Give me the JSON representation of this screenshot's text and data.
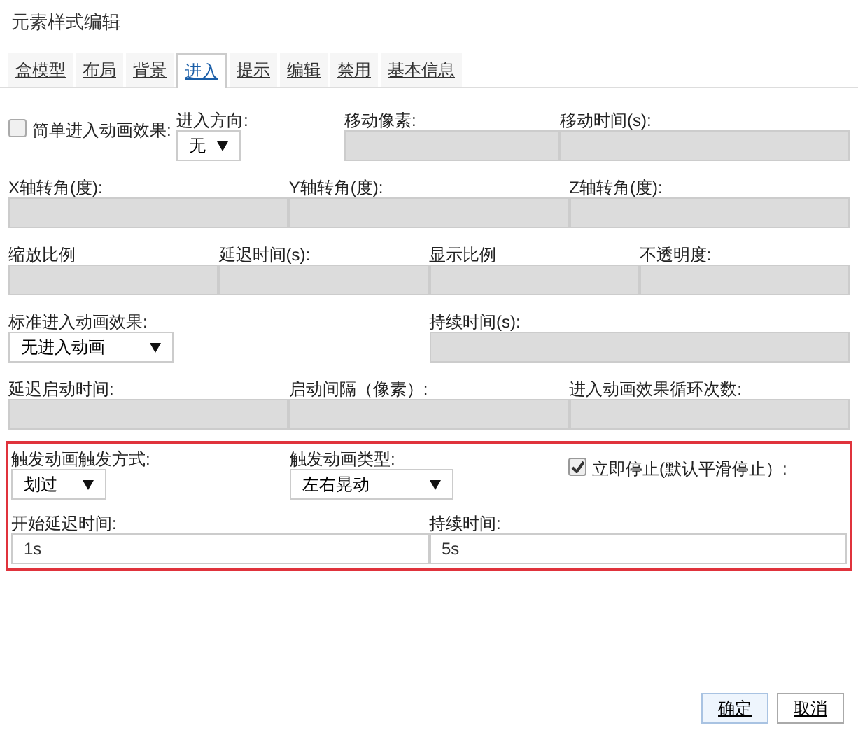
{
  "window": {
    "title": "元素样式编辑"
  },
  "tabs": [
    {
      "label": "盒模型",
      "selected": false
    },
    {
      "label": "布局",
      "selected": false
    },
    {
      "label": "背景",
      "selected": false
    },
    {
      "label": "进入",
      "selected": true
    },
    {
      "label": "提示",
      "selected": false
    },
    {
      "label": "编辑",
      "selected": false
    },
    {
      "label": "禁用",
      "selected": false
    },
    {
      "label": "基本信息",
      "selected": false
    }
  ],
  "rows": [
    {
      "fields": [
        {
          "kind": "checkbox",
          "label": "简单进入动画效果:",
          "checked": false
        },
        {
          "kind": "select",
          "label": "进入方向:",
          "value": "无"
        },
        {
          "kind": "input",
          "label": "移动像素:",
          "disabled": true
        },
        {
          "kind": "input",
          "label": "移动时间(s):",
          "disabled": true
        }
      ]
    },
    {
      "fields": [
        {
          "kind": "input",
          "label": "X轴转角(度):",
          "disabled": true
        },
        {
          "kind": "input",
          "label": "Y轴转角(度):",
          "disabled": true
        },
        {
          "kind": "input",
          "label": "Z轴转角(度):",
          "disabled": true
        }
      ]
    },
    {
      "fields": [
        {
          "kind": "input",
          "label": "缩放比例",
          "disabled": true
        },
        {
          "kind": "input",
          "label": "延迟时间(s):",
          "disabled": true
        },
        {
          "kind": "input",
          "label": "显示比例",
          "disabled": true
        },
        {
          "kind": "input",
          "label": "不透明度:",
          "disabled": true
        }
      ]
    },
    {
      "fields": [
        {
          "kind": "select",
          "label": "标准进入动画效果:",
          "value": "无进入动画"
        },
        {
          "kind": "input",
          "label": "持续时间(s):",
          "disabled": true
        }
      ]
    },
    {
      "fields": [
        {
          "kind": "input",
          "label": "延迟启动时间:",
          "disabled": true
        },
        {
          "kind": "input",
          "label": "启动间隔（像素）:",
          "disabled": true
        },
        {
          "kind": "input",
          "label": "进入动画效果循环次数:",
          "disabled": true
        }
      ]
    }
  ],
  "trigger": {
    "highlighted": true,
    "rows": [
      {
        "fields": [
          {
            "kind": "select",
            "label": "触发动画触发方式:",
            "value": "划过"
          },
          {
            "kind": "select",
            "label": "触发动画类型:",
            "value": "左右晃动"
          },
          {
            "kind": "checkbox",
            "label": "立即停止(默认平滑停止）:",
            "checked": true
          }
        ]
      },
      {
        "fields": [
          {
            "kind": "input",
            "label": "开始延迟时间:",
            "value": "1s",
            "disabled": false
          },
          {
            "kind": "input",
            "label": "持续时间:",
            "value": "5s",
            "disabled": false
          }
        ]
      }
    ]
  },
  "buttons": [
    {
      "label": "确定",
      "primary": true
    },
    {
      "label": "取消",
      "primary": false
    }
  ]
}
